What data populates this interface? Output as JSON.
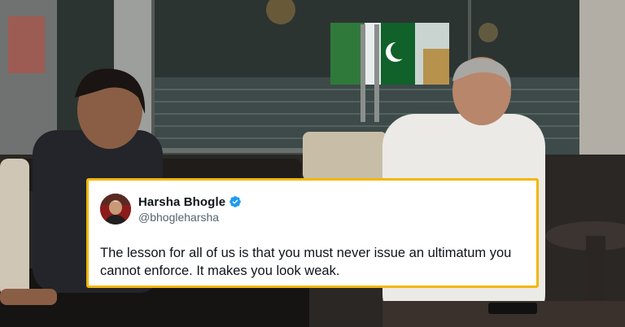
{
  "background": {
    "description_icon": "photo-two-men-talking-in-stadium-lounge",
    "accent_colors": {
      "card_border": "#f2b705",
      "verified": "#1d9bf0"
    }
  },
  "tweet": {
    "display_name": "Harsha Bhogle",
    "handle": "@bhogleharsha",
    "verified": true,
    "text": "The lesson for all of us is that you must never issue an ultimatum you cannot enforce. It makes you look weak."
  }
}
